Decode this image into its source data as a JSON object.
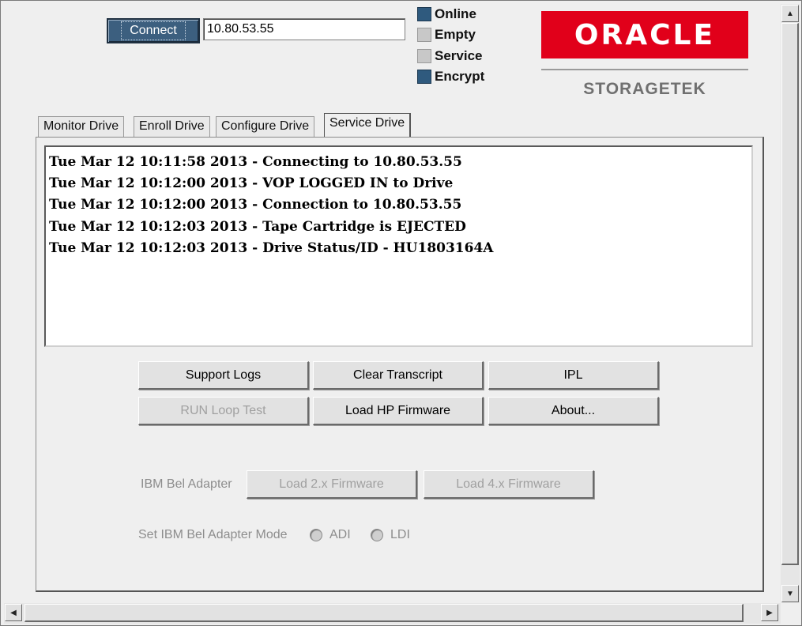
{
  "connection": {
    "connect_label": "Connect",
    "host_value": "10.80.53.55"
  },
  "status_indicators": [
    {
      "label": "Online",
      "state": "on"
    },
    {
      "label": "Empty",
      "state": "off"
    },
    {
      "label": "Service",
      "state": "off"
    },
    {
      "label": "Encrypt",
      "state": "on"
    }
  ],
  "brand": {
    "logo_text": "ORACLE",
    "subtitle": "STORAGETEK",
    "logo_color": "#e1001a"
  },
  "tabs": [
    {
      "label": "Monitor Drive",
      "active": false
    },
    {
      "label": "Enroll Drive",
      "active": false
    },
    {
      "label": "Configure Drive",
      "active": false
    },
    {
      "label": "Service Drive",
      "active": true
    }
  ],
  "transcript": [
    "Tue Mar 12 10:11:58 2013 - Connecting to 10.80.53.55",
    "Tue Mar 12 10:12:00 2013 - VOP LOGGED IN to Drive",
    "Tue Mar 12 10:12:00 2013 - Connection to 10.80.53.55",
    "Tue Mar 12 10:12:03 2013 - Tape Cartridge is EJECTED",
    "Tue Mar 12 10:12:03 2013 - Drive Status/ID - HU1803164A"
  ],
  "actions": {
    "support_logs": "Support Logs",
    "clear_transcript": "Clear Transcript",
    "ipl": "IPL",
    "run_loop_test": "RUN Loop Test",
    "load_hp_firmware": "Load HP Firmware",
    "about": "About..."
  },
  "ibm_adapter": {
    "label": "IBM Bel Adapter",
    "load_2x": "Load 2.x Firmware",
    "load_4x": "Load 4.x Firmware",
    "mode_label": "Set IBM Bel Adapter Mode",
    "mode_adi": "ADI",
    "mode_ldi": "LDI"
  }
}
